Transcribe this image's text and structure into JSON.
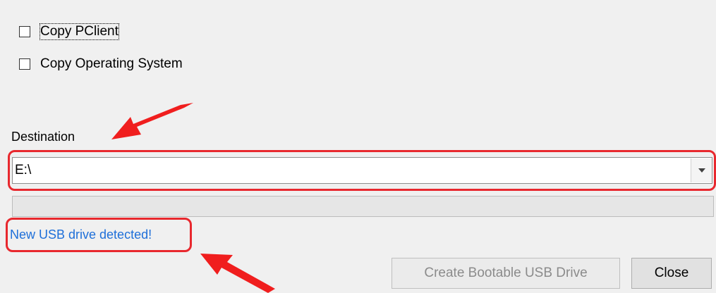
{
  "options": {
    "copy_pclient": {
      "label": "Copy PClient",
      "checked": false
    },
    "copy_os": {
      "label": "Copy Operating System",
      "checked": false
    }
  },
  "destination": {
    "label": "Destination",
    "value": "E:\\"
  },
  "progress": {
    "fraction": 0
  },
  "status": {
    "text": "New USB drive detected!",
    "color": "#1e6fd9"
  },
  "buttons": {
    "create_label": "Create Bootable USB Drive",
    "create_enabled": false,
    "close_label": "Close"
  },
  "annotations": {
    "highlight_color": "#e8282e",
    "arrow_icon": "red-pointer-arrow"
  }
}
